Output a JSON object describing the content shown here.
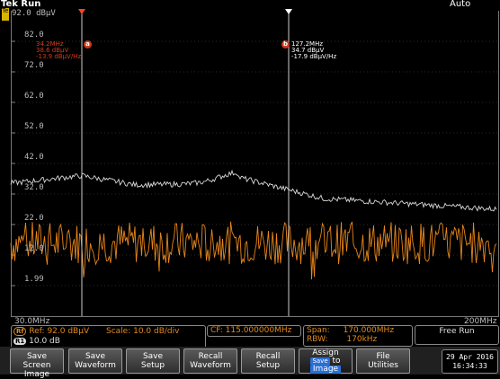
{
  "title_bar": {
    "app": "Tek Run",
    "mode": "Auto",
    "brand_mark": "Tek"
  },
  "ref_level_label": "92.0 dBµV",
  "y_axis_ticks": [
    "82.0",
    "72.0",
    "62.0",
    "52.0",
    "42.0",
    "32.0",
    "22.0",
    "12.0",
    "1.99"
  ],
  "y_axis_values": [
    82.0,
    72.0,
    62.0,
    52.0,
    42.0,
    32.0,
    22.0,
    12.0,
    1.99
  ],
  "x_axis": {
    "start": "30.0MHz",
    "end": "200MHz"
  },
  "markers": {
    "a": {
      "badge": "a",
      "line1": "34.2MHz",
      "line2": "38.6 dBµV",
      "line3": "-13.9 dBµV/Hz",
      "color": "#d63a1a"
    },
    "b": {
      "badge": "b",
      "line1": "127.2MHz",
      "line2": "34.7 dBµV",
      "line3": "-17.9 dBµV/Hz",
      "color": "#ffffff"
    }
  },
  "status": {
    "rf_tag": "Rf",
    "ref_text": "Ref: 92.0 dBµV",
    "scale_text": "Scale: 10.0 dB/div",
    "r1_tag": "R1",
    "r1_text": "10.0 dB",
    "cf_text": "CF: 115.000000MHz",
    "span_label": "Span:",
    "span_value": "170.000MHz",
    "rbw_label": "RBW:",
    "rbw_value": "170kHz",
    "free_run": "Free Run"
  },
  "softkeys": [
    {
      "line1": "Save",
      "line2": "Screen Image"
    },
    {
      "line1": "Save",
      "line2": "Waveform"
    },
    {
      "line1": "Save",
      "line2": "Setup"
    },
    {
      "line1": "Recall",
      "line2": "Waveform"
    },
    {
      "line1": "Recall",
      "line2": "Setup"
    },
    {
      "line1": "Assign",
      "save": "Save",
      "to": "to",
      "image": "Image"
    },
    {
      "line1": "File",
      "line2": "Utilities"
    }
  ],
  "datetime": {
    "date": "29 Apr 2016",
    "time": "16:34:33"
  },
  "colors": {
    "noise": "#e8861a",
    "trace": "#d8d8d8",
    "marker_a": "#d63a1a",
    "background": "#000000"
  }
}
